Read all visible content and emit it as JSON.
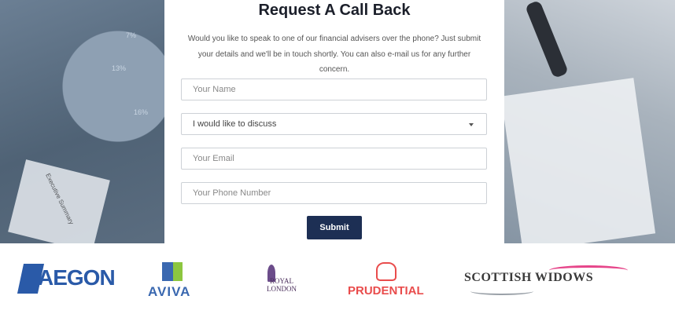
{
  "form": {
    "title": "Request A Call Back",
    "intro": "Would you like to speak to one of our financial advisers over the phone? Just submit your details and we'll be in touch shortly. You can also e-mail us for any further concern.",
    "name_placeholder": "Your Name",
    "discuss_selected": "I would like to discuss",
    "email_placeholder": "Your Email",
    "phone_placeholder": "Your Phone Number",
    "submit_label": "Submit"
  },
  "background": {
    "pie_labels": [
      "7%",
      "13%",
      "16%"
    ],
    "paper_text": "Executive Summary"
  },
  "partners": [
    {
      "name": "AEGON",
      "color": "#2a5aa8"
    },
    {
      "name": "AVIVA",
      "color": "#3a68b0"
    },
    {
      "name": "ROYAL LONDON",
      "color": "#4b2f5c"
    },
    {
      "name": "PRUDENTIAL",
      "color": "#e94c4c"
    },
    {
      "name": "SCOTTISH WIDOWS",
      "color": "#3a3a3a"
    }
  ]
}
